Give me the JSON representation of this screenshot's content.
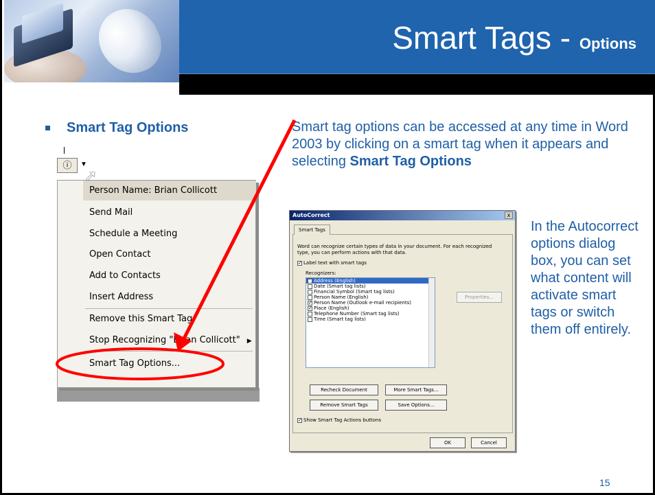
{
  "header": {
    "title_main": "Smart Tags - ",
    "title_sub": "Options"
  },
  "bullet": {
    "label": "Smart Tag Options"
  },
  "description": {
    "before_bold": "Smart tag options can be accessed at any time in Word 2003 by clicking on a smart tag when it appears and selecting ",
    "bold": "Smart Tag Options"
  },
  "context_menu": {
    "tag_icon": "info-icon",
    "items": [
      {
        "label": "Person Name: Brian Collicott"
      },
      {
        "label": "Send Mail"
      },
      {
        "label": "Schedule a Meeting"
      },
      {
        "label": "Open Contact"
      },
      {
        "label": "Add to Contacts"
      },
      {
        "label": "Insert Address"
      },
      {
        "label": "Remove this Smart Tag"
      },
      {
        "label": "Stop Recognizing \"Brian Collicott\""
      },
      {
        "label": "Smart Tag Options..."
      }
    ]
  },
  "dialog": {
    "title": "AutoCorrect",
    "close": "x",
    "tab": "Smart Tags",
    "intro": "Word can recognize certain types of data in your document. For each recognized type, you can perform actions with that data.",
    "label_checkbox": "Label text with smart tags",
    "recognizers_label": "Recognizers:",
    "recognizers": [
      {
        "label": "Address (English)",
        "checked": "true"
      },
      {
        "label": "Date (Smart tag lists)",
        "checked": "false"
      },
      {
        "label": "Financial Symbol (Smart tag lists)",
        "checked": "false"
      },
      {
        "label": "Person Name (English)",
        "checked": "false"
      },
      {
        "label": "Person Name (Outlook e-mail recipients)",
        "checked": "true"
      },
      {
        "label": "Place (English)",
        "checked": "true"
      },
      {
        "label": "Telephone Number (Smart tag lists)",
        "checked": "false"
      },
      {
        "label": "Time (Smart tag lists)",
        "checked": "false"
      }
    ],
    "properties_button": "Properties...",
    "recheck_button": "Recheck Document",
    "more_button": "More Smart Tags...",
    "remove_button": "Remove Smart Tags",
    "save_button": "Save Options...",
    "show_buttons_checkbox": "Show Smart Tag Actions buttons",
    "ok_button": "OK",
    "cancel_button": "Cancel"
  },
  "side_paragraph": "In the Autocorrect options dialog box, you can set what content will activate smart tags or switch them off entirely.",
  "page_number": "15",
  "colors": {
    "brand_blue": "#1f64ad",
    "text_blue": "#1f5fa6",
    "annotation_red": "#ff0000"
  }
}
